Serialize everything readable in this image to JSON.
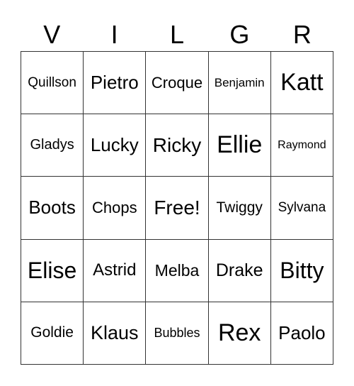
{
  "header": [
    "V",
    "I",
    "L",
    "G",
    "R"
  ],
  "cells": [
    [
      "Quillson",
      "Pietro",
      "Croque",
      "Benjamin",
      "Katt"
    ],
    [
      "Gladys",
      "Lucky",
      "Ricky",
      "Ellie",
      "Raymond"
    ],
    [
      "Boots",
      "Chops",
      "Free!",
      "Twiggy",
      "Sylvana"
    ],
    [
      "Elise",
      "Astrid",
      "Melba",
      "Drake",
      "Bitty"
    ],
    [
      "Goldie",
      "Klaus",
      "Bubbles",
      "Rex",
      "Paolo"
    ]
  ]
}
